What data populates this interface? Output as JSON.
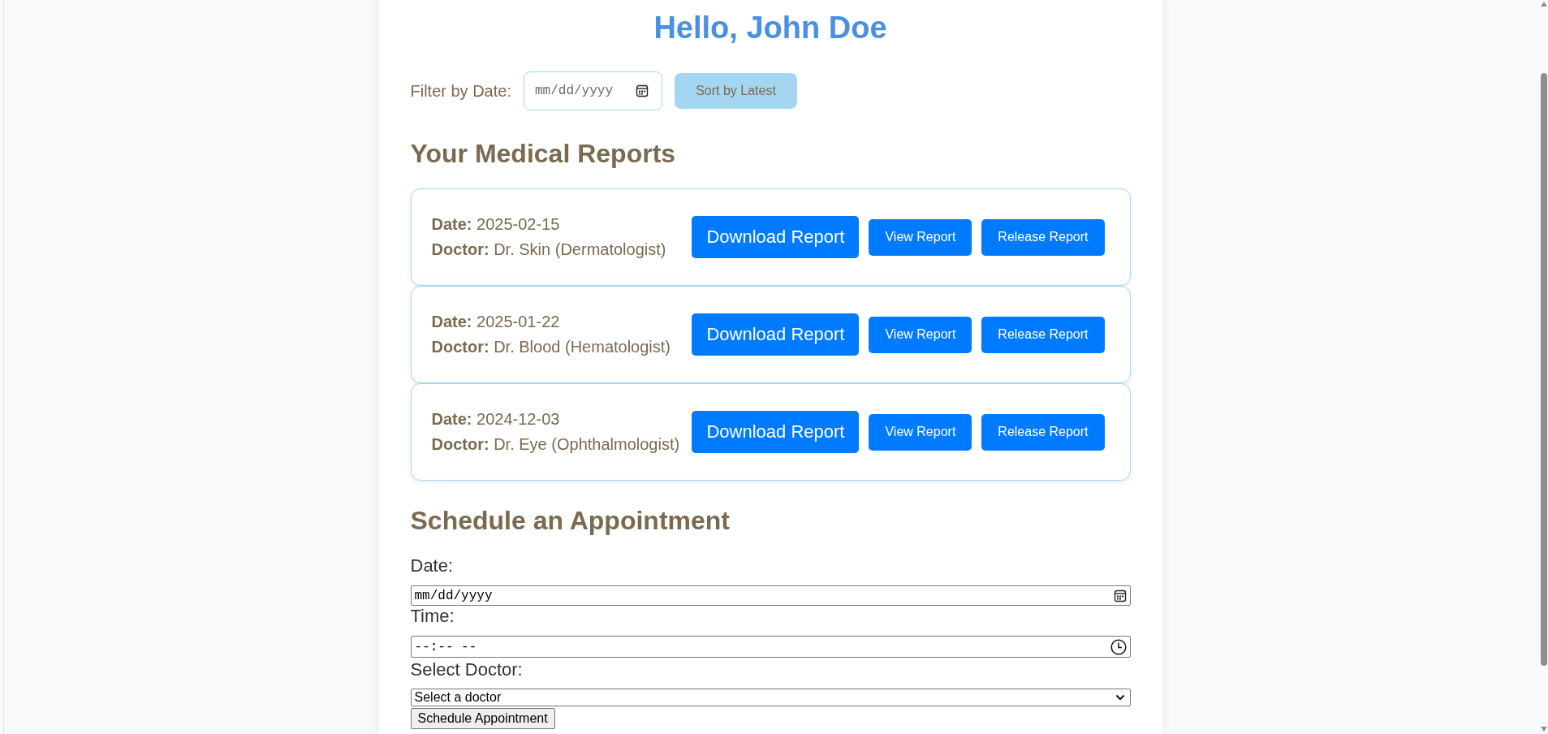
{
  "greeting": "Hello, John Doe",
  "filter": {
    "label": "Filter by Date:",
    "date_field": {
      "placeholder": "mm/dd/yyyy"
    },
    "sort_button": "Sort by Latest"
  },
  "reports_section": {
    "title": "Your Medical Reports",
    "reports": [
      {
        "date": "**Date:** 2025-02-15",
        "doctor": "**Doctor:** Dr. Skin (Dermatologist)",
        "actions": [
          {
            "kind": "download",
            "label": "Download Report"
          },
          {
            "kind": "view",
            "label": "View Report"
          },
          {
            "kind": "release",
            "label": "Release Report"
          }
        ]
      },
      {
        "date": "**Date:** 2025-01-22",
        "doctor": "**Doctor:** Dr. Blood (Hematologist)",
        "actions": [
          {
            "kind": "download",
            "label": "Download Report"
          },
          {
            "kind": "view",
            "label": "View Report"
          },
          {
            "kind": "release",
            "label": "Release Report"
          }
        ]
      },
      {
        "date": "**Date:** 2024-12-03",
        "doctor": "**Doctor:** Dr. Eye (Ophthalmologist)",
        "actions": [
          {
            "kind": "download",
            "label": "Download Report"
          },
          {
            "kind": "view",
            "label": "View Report"
          },
          {
            "kind": "release",
            "label": "Release Report"
          }
        ]
      }
    ]
  },
  "appointment_form": {
    "title": "Schedule an Appointment",
    "fields": [
      {
        "kind": "date",
        "label": "Date:",
        "placeholder": "mm/dd/yyyy"
      },
      {
        "kind": "time",
        "label": "Time:",
        "placeholder": "--:-- --"
      },
      {
        "kind": "select",
        "label": "Select Doctor:",
        "value": "Select a doctor"
      }
    ],
    "submit": "Schedule Appointment"
  }
}
